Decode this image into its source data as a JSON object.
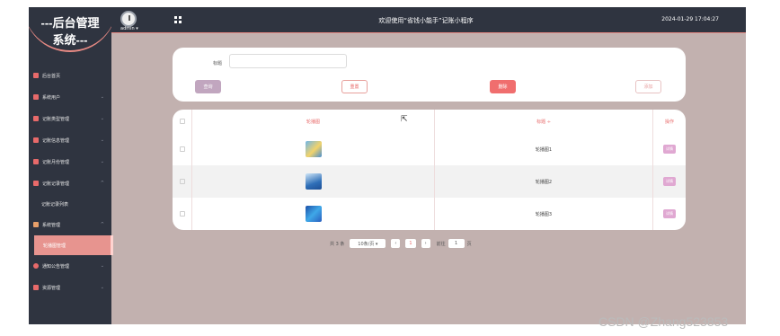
{
  "brand": {
    "line1": "---后台管理",
    "line2": "系统---"
  },
  "header": {
    "user": "admin ▾",
    "title": "欢迎使用“省钱小能手”记账小程序",
    "datetime": "2024-01-29 17:04:27"
  },
  "sidebar": {
    "items": [
      {
        "label": "后台首页",
        "icon": "home-icon",
        "expandable": false
      },
      {
        "label": "系统用户",
        "icon": "user-icon",
        "expandable": true
      },
      {
        "label": "记账类型管理",
        "icon": "list-icon",
        "expandable": true
      },
      {
        "label": "记账信息管理",
        "icon": "list-icon",
        "expandable": true
      },
      {
        "label": "记账月份管理",
        "icon": "list-icon",
        "expandable": true
      },
      {
        "label": "记账记录管理",
        "icon": "list-icon",
        "expandable": true,
        "expanded": true
      },
      {
        "label": "系统管理",
        "icon": "chart-icon",
        "expandable": true,
        "expanded": true
      },
      {
        "label": "通知公告管理",
        "icon": "bell-icon",
        "expandable": true
      },
      {
        "label": "资源管理",
        "icon": "flag-icon",
        "expandable": true
      }
    ],
    "sub_record": "记账记录列表",
    "sub_carousel": "轮播图管理"
  },
  "search": {
    "label": "标题",
    "value": "",
    "placeholder": ""
  },
  "buttons": {
    "query": "查询",
    "reset": "重置",
    "delete": "删除",
    "add": "添加"
  },
  "table": {
    "headers": [
      "轮播图",
      "标题 ÷",
      "操作"
    ],
    "rows": [
      {
        "title": "轮播图1",
        "action": "详情"
      },
      {
        "title": "轮播图2",
        "action": "详情"
      },
      {
        "title": "轮播图3",
        "action": "详情"
      }
    ]
  },
  "pagination": {
    "total": "共 3 条",
    "page_size": "10条/页 ▾",
    "prev": "‹",
    "current": "1",
    "next": "›",
    "goto": "前往",
    "goto_value": "1",
    "page_unit": "页"
  },
  "colors": {
    "sidebar": "#2f3440",
    "accent": "#e86a6a",
    "content_bg": "#c2b1af"
  },
  "watermark": "CSDN @Zhang523853"
}
